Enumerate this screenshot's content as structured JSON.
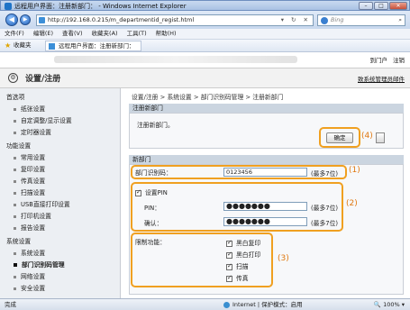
{
  "window": {
    "title": "远程用户界面：注册新部门：",
    "browser": "Windows Internet Explorer",
    "buttons": {
      "minimize": "–",
      "maximize": "□",
      "close": "✕"
    }
  },
  "address_bar": {
    "url": "http://192.168.0.215/m_departmentid_regist.html",
    "search_placeholder": "Bing",
    "back": "◀",
    "forward": "▶",
    "controls": "▾ ↻ ✕",
    "search_icon": "⌕"
  },
  "menu": [
    "文件(F)",
    "编辑(E)",
    "查看(V)",
    "收藏夹(A)",
    "工具(T)",
    "帮助(H)"
  ],
  "favorites": {
    "label": "收藏夹",
    "tab": "远程用户界面：注册新部门："
  },
  "top_links": [
    "到门户",
    "注销"
  ],
  "header": {
    "title": "设置/注册",
    "admin_mail": "致系统管理员邮件",
    "icon": "⚙"
  },
  "sidebar": {
    "sections": [
      {
        "label": "首选项",
        "items": [
          "纸张设置",
          "自定调整/显示设置",
          "定时器设置"
        ]
      },
      {
        "label": "功能设置",
        "items": [
          "常用设置",
          "复印设置",
          "传真设置",
          "扫描设置",
          "USB直接打印设置",
          "打印机设置",
          "报告设置"
        ]
      },
      {
        "label": "系统设置",
        "items": [
          "系统设置",
          "部门识别码管理",
          "网络设置",
          "安全设置"
        ]
      }
    ],
    "active_item": "部门识别码管理"
  },
  "breadcrumb": "设置/注册 > 系统设置 > 部门识别码管理 > 注册新部门",
  "register_panel": {
    "head": "注册新部门",
    "message": "注册新部门。",
    "ok_label": "确定",
    "callout": "(4)"
  },
  "dept_panel": {
    "head": "新部门",
    "dept_id_label": "部门识别码：",
    "dept_id_value": "0123456",
    "dept_id_hint": "(最多7位)",
    "callout_1": "(1)",
    "set_pin_label": "设置PIN",
    "pin_label": "PIN：",
    "pin_value": "●●●●●●●",
    "pin_hint": "(最多7位)",
    "confirm_label": "确认：",
    "confirm_value": "●●●●●●●",
    "confirm_hint": "(最多7位)",
    "callout_2": "(2)",
    "restrict_label": "限制功能：",
    "restrict_items": [
      "黑白复印",
      "黑白打印",
      "扫描",
      "传真"
    ],
    "callout_3": "(3)"
  },
  "status_bar": {
    "left": "完成",
    "zone": "Internet | 保护模式：启用",
    "zoom": "100%"
  }
}
